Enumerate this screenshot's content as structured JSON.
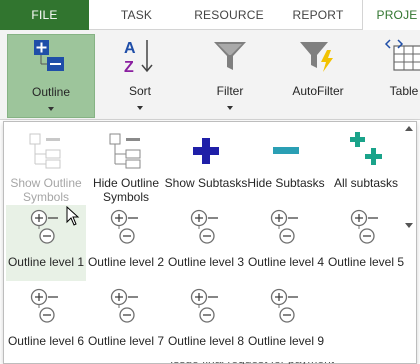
{
  "tabs": {
    "file": "FILE",
    "task": "TASK",
    "resource": "RESOURCE",
    "report": "REPORT",
    "project": "PROJE"
  },
  "ribbon": {
    "outline": "Outline",
    "sort": "Sort",
    "filter": "Filter",
    "autofilter": "AutoFilter",
    "table": "Table"
  },
  "menu": {
    "show_outline_symbols": "Show Outline Symbols",
    "hide_outline_symbols": "Hide Outline Symbols",
    "show_subtasks": "Show Subtasks",
    "hide_subtasks": "Hide Subtasks",
    "all_subtasks": "All subtasks",
    "levels": [
      "Outline level 1",
      "Outline level 2",
      "Outline level 3",
      "Outline level 4",
      "Outline level 5",
      "Outline level 6",
      "Outline level 7",
      "Outline level 8",
      "Outline level 9"
    ]
  },
  "background_row_text": "Issue final request for payment",
  "colors": {
    "file_tab": "#31752f",
    "outline_selected": "#9dc59b",
    "plus_blue": "#1f1fa8",
    "minus_teal": "#2a9fb4",
    "all_subtasks_green": "#1aa38a"
  }
}
